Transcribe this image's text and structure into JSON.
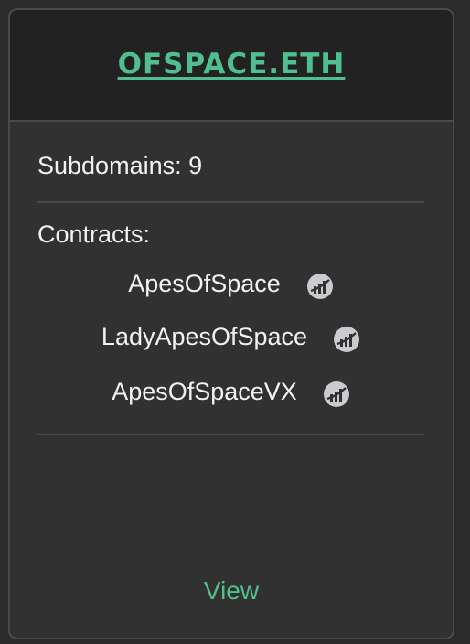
{
  "card": {
    "domain": "OFSPACE.ETH",
    "subdomains_label": "Subdomains: 9",
    "contracts_label": "Contracts:",
    "contracts": [
      {
        "name": "ApesOfSpace",
        "icon": "chart-icon"
      },
      {
        "name": "LadyApesOfSpace",
        "icon": "chart-icon"
      },
      {
        "name": "ApesOfSpaceVX",
        "icon": "chart-icon"
      }
    ],
    "view_label": "View"
  },
  "colors": {
    "accent": "#4fbf8f",
    "background": "#2b2b2b",
    "card": "#313131",
    "header": "#222222",
    "text": "#f2f2f2",
    "icon": "#c9cbcf"
  }
}
